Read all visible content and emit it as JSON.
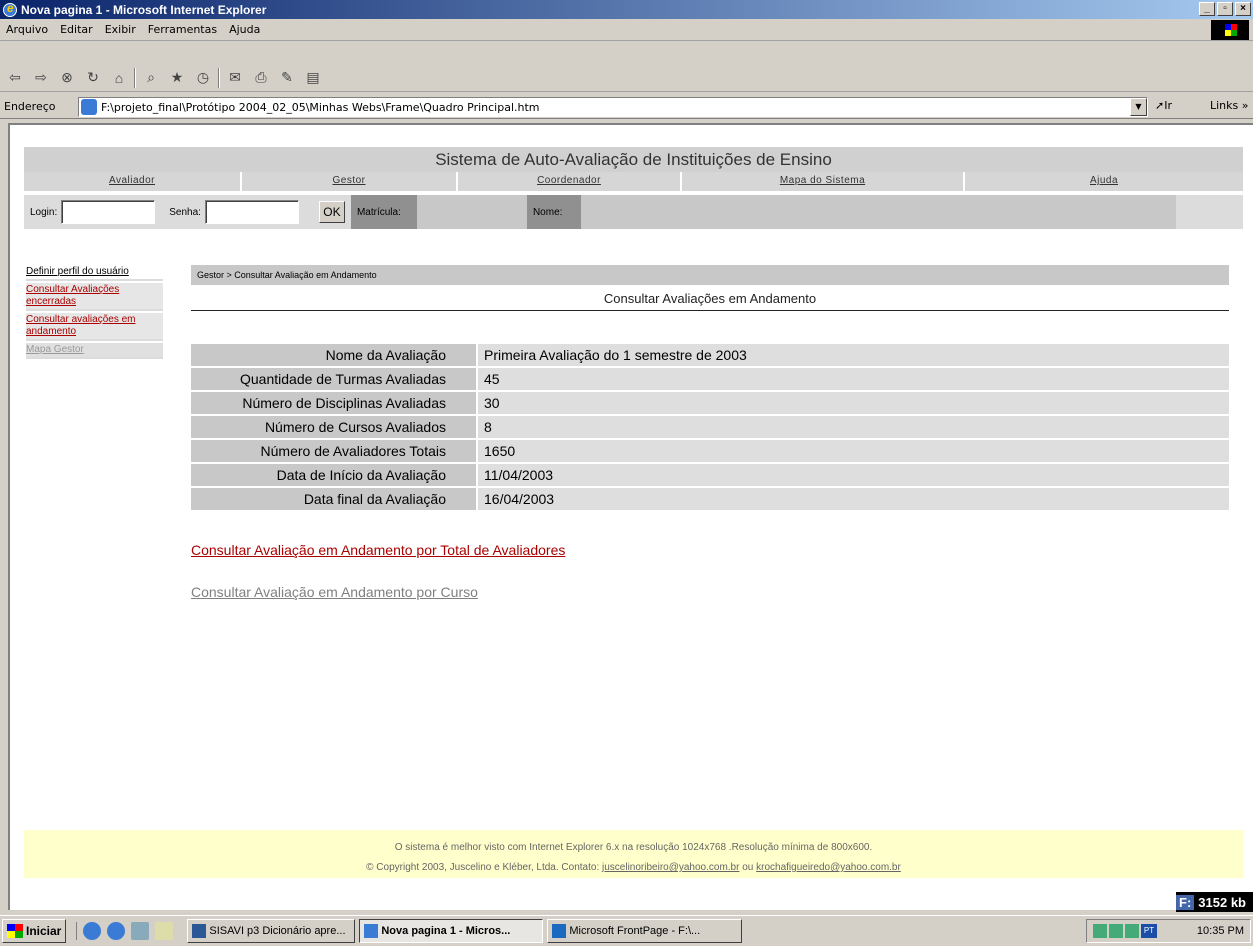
{
  "window": {
    "title": "Nova pagina 1 - Microsoft Internet Explorer"
  },
  "menu": [
    "Arquivo",
    "Editar",
    "Exibir",
    "Ferramentas",
    "Ajuda"
  ],
  "address": {
    "label": "Endereço",
    "url": "F:\\projeto_final\\Protótipo 2004_02_05\\Minhas Webs\\Frame\\Quadro Principal.htm",
    "go_label": "Ir",
    "links_label": "Links »"
  },
  "site": {
    "title": "Sistema de Auto-Avaliação de Instituições de Ensino",
    "nav": [
      "Avaliador",
      "Gestor",
      "Coordenador",
      "Mapa do Sistema",
      "Ajuda"
    ],
    "login": {
      "login_label": "Login:",
      "senha_label": "Senha:",
      "ok_label": "OK",
      "matricula_label": "Matrícula:",
      "nome_label": "Nome:"
    },
    "sidebar": [
      "Definir perfil do usuário",
      "Consultar Avaliações encerradas",
      "Consultar avaliações em andamento",
      "Mapa Gestor"
    ],
    "breadcrumb": "Gestor > Consultar Avaliação em Andamento",
    "content_title": "Consultar Avaliações em Andamento",
    "rows": [
      {
        "label": "Nome da Avaliação",
        "value": "Primeira Avaliação do 1 semestre de 2003"
      },
      {
        "label": "Quantidade de Turmas Avaliadas",
        "value": "45"
      },
      {
        "label": "Número de Disciplinas Avaliadas",
        "value": "30"
      },
      {
        "label": "Número de Cursos Avaliados",
        "value": "8"
      },
      {
        "label": "Número de Avaliadores Totais",
        "value": "1650"
      },
      {
        "label": "Data de Início da Avaliação",
        "value": "11/04/2003"
      },
      {
        "label": "Data final da Avaliação",
        "value": "16/04/2003"
      }
    ],
    "link_total": "Consultar Avaliação em Andamento por Total de Avaliadores",
    "link_curso": "Consultar Avaliação em Andamento por Curso",
    "footer": {
      "line1": "O sistema é melhor visto com Internet Explorer 6.x na resolução 1024x768 .Resolução mínima de 800x600.",
      "line2_prefix": "© Copyright 2003, Juscelino e Kléber, Ltda. Contato: ",
      "email1": "juscelinoribeiro@yahoo.com.br",
      "or": " ou ",
      "email2": "krochafigueiredo@yahoo.com.br"
    }
  },
  "status": {
    "drive": "F:",
    "memory": "3152 kb"
  },
  "taskbar": {
    "start": "Iniciar",
    "tasks": [
      "SISAVI p3 Dicionário apre...",
      "Nova pagina 1 - Micros...",
      "Microsoft FrontPage - F:\\..."
    ],
    "lang": "PT",
    "clock": "10:35 PM"
  }
}
